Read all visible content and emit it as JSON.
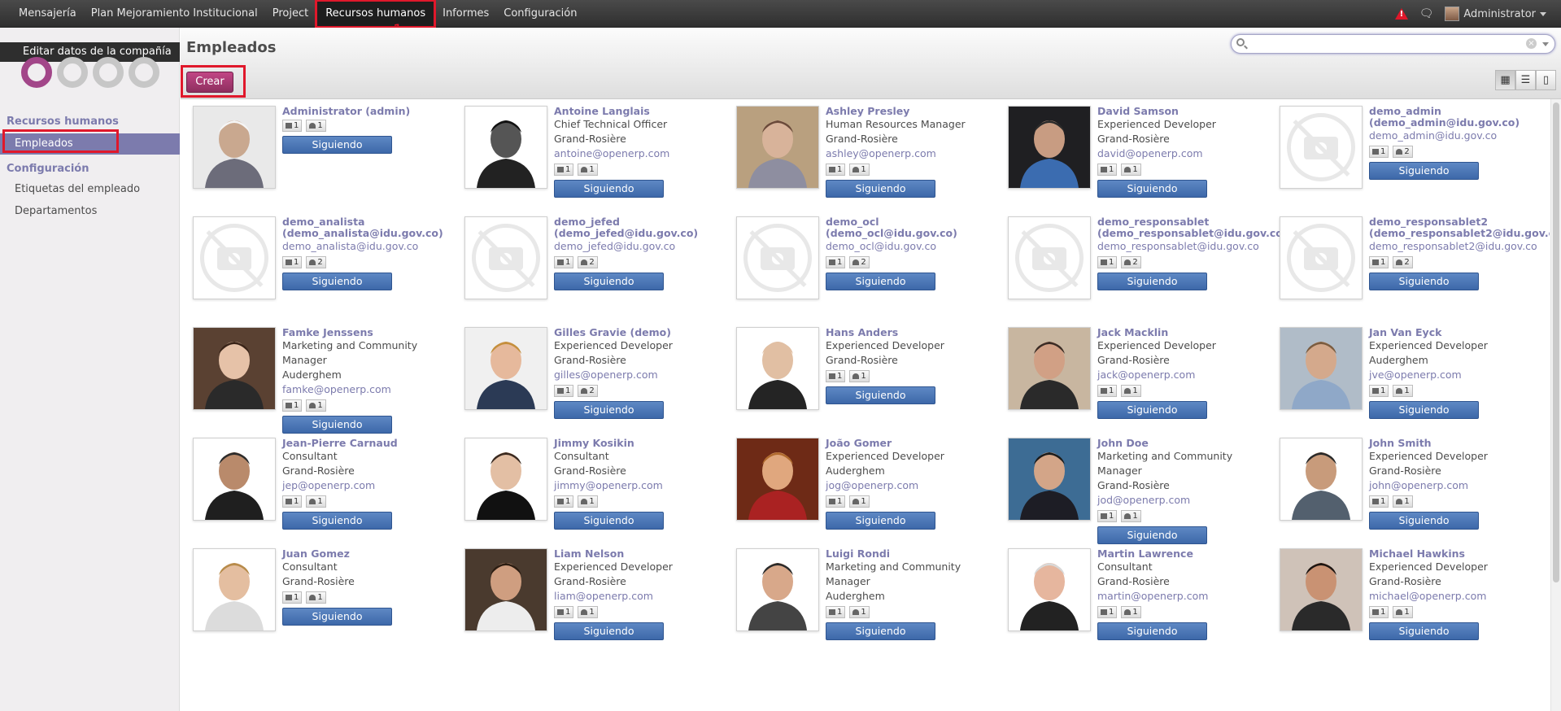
{
  "topbar": {
    "menu": [
      "Mensajería",
      "Plan Mejoramiento Institucional",
      "Project",
      "Recursos humanos",
      "Informes",
      "Configuración"
    ],
    "active_index": 3,
    "user": "Administrator"
  },
  "annotations": [
    "1",
    "2",
    "3"
  ],
  "sidebar": {
    "company_edit": "Editar datos de la compañía",
    "section1": "Recursos humanos",
    "item_empleados": "Empleados",
    "section2": "Configuración",
    "item_etiquetas": "Etiquetas del empleado",
    "item_departamentos": "Departamentos"
  },
  "header": {
    "title": "Empleados",
    "create_label": "Crear",
    "search_value": ""
  },
  "follow_label": "Siguiendo",
  "employees": [
    {
      "name": "Administrator (admin)",
      "lines": [],
      "email": "",
      "c1": "1",
      "c2": "1",
      "photo": "admin"
    },
    {
      "name": "Antoine Langlais",
      "lines": [
        "Chief Technical Officer",
        "Grand-Rosière"
      ],
      "email": "antoine@openerp.com",
      "c1": "1",
      "c2": "1",
      "photo": "bw"
    },
    {
      "name": "Ashley Presley",
      "lines": [
        "Human Resources Manager",
        "Grand-Rosière"
      ],
      "email": "ashley@openerp.com",
      "c1": "1",
      "c2": "1",
      "photo": "ashley"
    },
    {
      "name": "David Samson",
      "lines": [
        "Experienced Developer",
        "Grand-Rosière"
      ],
      "email": "david@openerp.com",
      "c1": "1",
      "c2": "1",
      "photo": "david"
    },
    {
      "name": "demo_admin (demo_admin@idu.gov.co)",
      "lines": [],
      "email": "demo_admin@idu.gov.co",
      "c1": "1",
      "c2": "2",
      "photo": "none"
    },
    {
      "name": "demo_analista (demo_analista@idu.gov.co)",
      "lines": [],
      "email": "demo_analista@idu.gov.co",
      "c1": "1",
      "c2": "2",
      "photo": "none"
    },
    {
      "name": "demo_jefed (demo_jefed@idu.gov.co)",
      "lines": [],
      "email": "demo_jefed@idu.gov.co",
      "c1": "1",
      "c2": "2",
      "photo": "none"
    },
    {
      "name": "demo_ocl (demo_ocl@idu.gov.co)",
      "lines": [],
      "email": "demo_ocl@idu.gov.co",
      "c1": "1",
      "c2": "2",
      "photo": "none"
    },
    {
      "name": "demo_responsablet (demo_responsablet@idu.gov.co)",
      "lines": [],
      "email": "demo_responsablet@idu.gov.co",
      "c1": "1",
      "c2": "2",
      "photo": "none"
    },
    {
      "name": "demo_responsablet2 (demo_responsablet2@idu.gov.co)",
      "lines": [],
      "email": "demo_responsablet2@idu.gov.co",
      "c1": "1",
      "c2": "2",
      "photo": "none"
    },
    {
      "name": "Famke Jenssens",
      "lines": [
        "Marketing and Community",
        "Manager",
        "Auderghem"
      ],
      "email": "famke@openerp.com",
      "c1": "1",
      "c2": "1",
      "photo": "famke"
    },
    {
      "name": "Gilles Gravie (demo)",
      "lines": [
        "Experienced Developer",
        "Grand-Rosière"
      ],
      "email": "gilles@openerp.com",
      "c1": "1",
      "c2": "2",
      "photo": "gilles"
    },
    {
      "name": "Hans Anders",
      "lines": [
        "Experienced Developer",
        "Grand-Rosière"
      ],
      "email": "",
      "c1": "1",
      "c2": "1",
      "photo": "hans"
    },
    {
      "name": "Jack Macklin",
      "lines": [
        "Experienced Developer",
        "Grand-Rosière"
      ],
      "email": "jack@openerp.com",
      "c1": "1",
      "c2": "1",
      "photo": "jack"
    },
    {
      "name": "Jan Van Eyck",
      "lines": [
        "Experienced Developer",
        "Auderghem"
      ],
      "email": "jve@openerp.com",
      "c1": "1",
      "c2": "1",
      "photo": "jan"
    },
    {
      "name": "Jean-Pierre Carnaud",
      "lines": [
        "Consultant",
        "Grand-Rosière"
      ],
      "email": "jep@openerp.com",
      "c1": "1",
      "c2": "1",
      "photo": "jp"
    },
    {
      "name": "Jimmy Kosikin",
      "lines": [
        "Consultant",
        "Grand-Rosière"
      ],
      "email": "jimmy@openerp.com",
      "c1": "1",
      "c2": "1",
      "photo": "jimmy"
    },
    {
      "name": "João Gomer",
      "lines": [
        "Experienced Developer",
        "Auderghem"
      ],
      "email": "jog@openerp.com",
      "c1": "1",
      "c2": "1",
      "photo": "joao"
    },
    {
      "name": "John Doe",
      "lines": [
        "Marketing and Community",
        "Manager",
        "Grand-Rosière"
      ],
      "email": "jod@openerp.com",
      "c1": "1",
      "c2": "1",
      "photo": "johndoe"
    },
    {
      "name": "John Smith",
      "lines": [
        "Experienced Developer",
        "Grand-Rosière"
      ],
      "email": "john@openerp.com",
      "c1": "1",
      "c2": "1",
      "photo": "smith"
    },
    {
      "name": "Juan Gomez",
      "lines": [
        "Consultant",
        "Grand-Rosière"
      ],
      "email": "",
      "c1": "1",
      "c2": "1",
      "photo": "juan"
    },
    {
      "name": "Liam Nelson",
      "lines": [
        "Experienced Developer",
        "Grand-Rosière"
      ],
      "email": "liam@openerp.com",
      "c1": "1",
      "c2": "1",
      "photo": "liam"
    },
    {
      "name": "Luigi Rondi",
      "lines": [
        "Marketing and Community",
        "Manager",
        "Auderghem"
      ],
      "email": "",
      "c1": "1",
      "c2": "1",
      "photo": "luigi"
    },
    {
      "name": "Martin Lawrence",
      "lines": [
        "Consultant",
        "Grand-Rosière"
      ],
      "email": "martin@openerp.com",
      "c1": "1",
      "c2": "1",
      "photo": "martin"
    },
    {
      "name": "Michael Hawkins",
      "lines": [
        "Experienced Developer",
        "Grand-Rosière"
      ],
      "email": "michael@openerp.com",
      "c1": "1",
      "c2": "1",
      "photo": "michael"
    }
  ]
}
